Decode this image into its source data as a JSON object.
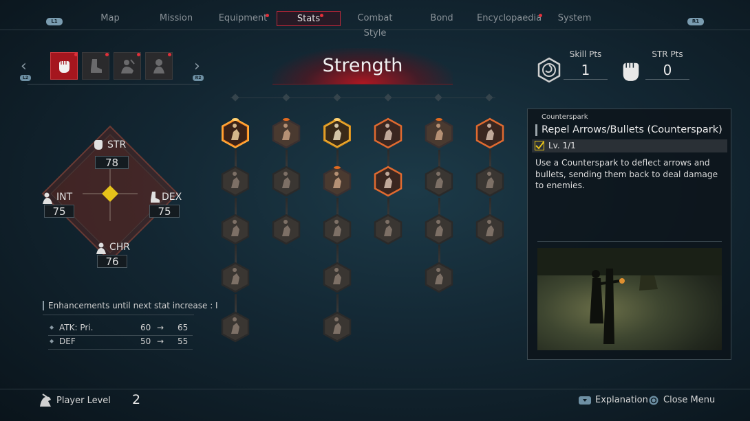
{
  "nav": {
    "left_button": "L1",
    "right_button": "R1",
    "tabs": [
      {
        "label": "Map"
      },
      {
        "label": "Mission"
      },
      {
        "label": "Equipment"
      },
      {
        "label": "Stats"
      },
      {
        "label": "Combat Style"
      },
      {
        "label": "Bond"
      },
      {
        "label": "Encyclopaedia"
      },
      {
        "label": "System"
      }
    ],
    "active": "Stats"
  },
  "stat_tabs": {
    "left_button": "L2",
    "right_button": "R2",
    "items": [
      {
        "icon": "fist-icon",
        "active": true
      },
      {
        "icon": "boot-icon",
        "active": false
      },
      {
        "icon": "scholar-icon",
        "active": false
      },
      {
        "icon": "charisma-icon",
        "active": false
      }
    ]
  },
  "header": {
    "title": "Strength"
  },
  "points": {
    "skill_label": "Skill Pts",
    "skill_value": "1",
    "str_label": "STR Pts",
    "str_value": "0"
  },
  "stats": {
    "str": {
      "name": "STR",
      "value": "78"
    },
    "int": {
      "name": "INT",
      "value": "75"
    },
    "dex": {
      "name": "DEX",
      "value": "75"
    },
    "chr": {
      "name": "CHR",
      "value": "76"
    }
  },
  "enhancements": {
    "title": "Enhancements until next stat increase : I",
    "rows": [
      {
        "label": "ATK: Pri.",
        "from": "60",
        "arrow": "→",
        "to": "65"
      },
      {
        "label": "DEF",
        "from": "50",
        "arrow": "→",
        "to": "55"
      }
    ]
  },
  "detail": {
    "category": "Counterspark",
    "title": "Repel Arrows/Bullets (Counterspark)",
    "level": "Lv. 1/1",
    "description": "Use a Counterspark to deflect arrows and bullets, sending them back to deal damage to enemies."
  },
  "bottom": {
    "player_label": "Player Level",
    "player_level": "2",
    "explanation": "Explanation",
    "close": "Close Menu"
  },
  "colors": {
    "accent_red": "#c0283a",
    "gold": "#e8a020",
    "orange": "#e06a20",
    "stat_diamond": "#e6c21a"
  }
}
